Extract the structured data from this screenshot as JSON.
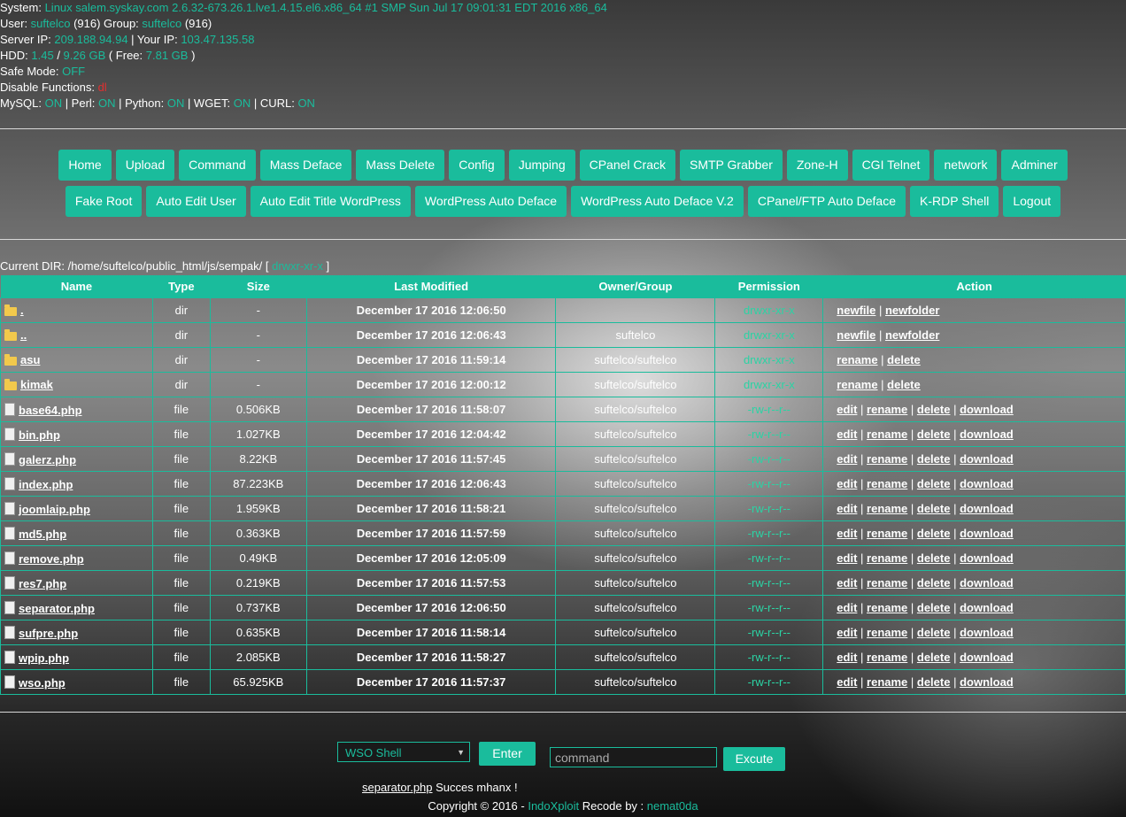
{
  "info": {
    "system_label": "System: ",
    "system_value": "Linux salem.syskay.com 2.6.32-673.26.1.lve1.4.15.el6.x86_64 #1 SMP Sun Jul 17 09:01:31 EDT 2016 x86_64",
    "user_label": "User: ",
    "user_value": "suftelco",
    "user_id": " (916) Group: ",
    "group_value": "suftelco",
    "group_id": " (916)",
    "server_ip_label": "Server IP: ",
    "server_ip": "209.188.94.94",
    "your_ip_label": " | Your IP: ",
    "your_ip": "103.47.135.58",
    "hdd_label": "HDD: ",
    "hdd_used": "1.45",
    "hdd_sep": " / ",
    "hdd_total": "9.26 GB",
    "free_label": " ( Free: ",
    "free_value": "7.81 GB",
    "free_close": " )",
    "safe_mode_label": "Safe Mode: ",
    "safe_mode_value": "OFF",
    "disable_label": "Disable Functions: ",
    "disable_value": "dl",
    "mysql_label": "MySQL: ",
    "mysql_value": "ON",
    "perl_label": " | Perl: ",
    "perl_value": "ON",
    "python_label": " | Python: ",
    "python_value": "ON",
    "wget_label": " | WGET: ",
    "wget_value": "ON",
    "curl_label": " | CURL: ",
    "curl_value": "ON"
  },
  "nav": {
    "row1": [
      "Home",
      "Upload",
      "Command",
      "Mass Deface",
      "Mass Delete",
      "Config",
      "Jumping",
      "CPanel Crack",
      "SMTP Grabber",
      "Zone-H",
      "CGI Telnet",
      "network",
      "Adminer"
    ],
    "row2": [
      "Fake Root",
      "Auto Edit User",
      "Auto Edit Title WordPress",
      "WordPress Auto Deface",
      "WordPress Auto Deface V.2",
      "CPanel/FTP Auto Deface",
      "K-RDP Shell",
      "Logout"
    ]
  },
  "current_dir": {
    "label": "Current DIR: ",
    "path": "/home/suftelco/public_html/js/sempak/",
    "perm_open": "[ ",
    "perm": "drwxr-xr-x",
    "perm_close": " ]"
  },
  "table": {
    "headers": [
      "Name",
      "Type",
      "Size",
      "Last Modified",
      "Owner/Group",
      "Permission",
      "Action"
    ],
    "rows": [
      {
        "icon": "folder-icon",
        "name": ".",
        "type": "dir",
        "size": "-",
        "modified": "December 17 2016 12:06:50",
        "owner": "",
        "perm": "drwxr-xr-x",
        "actions": [
          "newfile",
          "newfolder"
        ]
      },
      {
        "icon": "folder-icon",
        "name": "..",
        "type": "dir",
        "size": "-",
        "modified": "December 17 2016 12:06:43",
        "owner": "suftelco",
        "perm": "drwxr-xr-x",
        "actions": [
          "newfile",
          "newfolder"
        ]
      },
      {
        "icon": "folder-icon",
        "name": "asu",
        "type": "dir",
        "size": "-",
        "modified": "December 17 2016 11:59:14",
        "owner": "suftelco/suftelco",
        "perm": "drwxr-xr-x",
        "actions": [
          "rename",
          "delete"
        ]
      },
      {
        "icon": "folder-icon",
        "name": "kimak",
        "type": "dir",
        "size": "-",
        "modified": "December 17 2016 12:00:12",
        "owner": "suftelco/suftelco",
        "perm": "drwxr-xr-x",
        "actions": [
          "rename",
          "delete"
        ]
      },
      {
        "icon": "file-icon",
        "name": "base64.php",
        "type": "file",
        "size": "0.506KB",
        "modified": "December 17 2016 11:58:07",
        "owner": "suftelco/suftelco",
        "perm": "-rw-r--r--",
        "actions": [
          "edit",
          "rename",
          "delete",
          "download"
        ]
      },
      {
        "icon": "file-icon",
        "name": "bin.php",
        "type": "file",
        "size": "1.027KB",
        "modified": "December 17 2016 12:04:42",
        "owner": "suftelco/suftelco",
        "perm": "-rw-r--r--",
        "actions": [
          "edit",
          "rename",
          "delete",
          "download"
        ]
      },
      {
        "icon": "file-icon",
        "name": "galerz.php",
        "type": "file",
        "size": "8.22KB",
        "modified": "December 17 2016 11:57:45",
        "owner": "suftelco/suftelco",
        "perm": "-rw-r--r--",
        "actions": [
          "edit",
          "rename",
          "delete",
          "download"
        ]
      },
      {
        "icon": "file-icon",
        "name": "index.php",
        "type": "file",
        "size": "87.223KB",
        "modified": "December 17 2016 12:06:43",
        "owner": "suftelco/suftelco",
        "perm": "-rw-r--r--",
        "actions": [
          "edit",
          "rename",
          "delete",
          "download"
        ]
      },
      {
        "icon": "file-icon",
        "name": "joomlaip.php",
        "type": "file",
        "size": "1.959KB",
        "modified": "December 17 2016 11:58:21",
        "owner": "suftelco/suftelco",
        "perm": "-rw-r--r--",
        "actions": [
          "edit",
          "rename",
          "delete",
          "download"
        ]
      },
      {
        "icon": "file-icon",
        "name": "md5.php",
        "type": "file",
        "size": "0.363KB",
        "modified": "December 17 2016 11:57:59",
        "owner": "suftelco/suftelco",
        "perm": "-rw-r--r--",
        "actions": [
          "edit",
          "rename",
          "delete",
          "download"
        ]
      },
      {
        "icon": "file-icon",
        "name": "remove.php",
        "type": "file",
        "size": "0.49KB",
        "modified": "December 17 2016 12:05:09",
        "owner": "suftelco/suftelco",
        "perm": "-rw-r--r--",
        "actions": [
          "edit",
          "rename",
          "delete",
          "download"
        ]
      },
      {
        "icon": "file-icon",
        "name": "res7.php",
        "type": "file",
        "size": "0.219KB",
        "modified": "December 17 2016 11:57:53",
        "owner": "suftelco/suftelco",
        "perm": "-rw-r--r--",
        "actions": [
          "edit",
          "rename",
          "delete",
          "download"
        ]
      },
      {
        "icon": "file-icon",
        "name": "separator.php",
        "type": "file",
        "size": "0.737KB",
        "modified": "December 17 2016 12:06:50",
        "owner": "suftelco/suftelco",
        "perm": "-rw-r--r--",
        "actions": [
          "edit",
          "rename",
          "delete",
          "download"
        ]
      },
      {
        "icon": "file-icon",
        "name": "sufpre.php",
        "type": "file",
        "size": "0.635KB",
        "modified": "December 17 2016 11:58:14",
        "owner": "suftelco/suftelco",
        "perm": "-rw-r--r--",
        "actions": [
          "edit",
          "rename",
          "delete",
          "download"
        ]
      },
      {
        "icon": "file-icon",
        "name": "wpip.php",
        "type": "file",
        "size": "2.085KB",
        "modified": "December 17 2016 11:58:27",
        "owner": "suftelco/suftelco",
        "perm": "-rw-r--r--",
        "actions": [
          "edit",
          "rename",
          "delete",
          "download"
        ]
      },
      {
        "icon": "file-icon",
        "name": "wso.php",
        "type": "file",
        "size": "65.925KB",
        "modified": "December 17 2016 11:57:37",
        "owner": "suftelco/suftelco",
        "perm": "-rw-r--r--",
        "actions": [
          "edit",
          "rename",
          "delete",
          "download"
        ]
      }
    ]
  },
  "bottom": {
    "select_value": "WSO Shell",
    "enter_label": "Enter",
    "command_placeholder": "command",
    "excute_label": "Excute",
    "msg_file": "separator.php",
    "msg_text": " Succes mhanx !",
    "copyright": "Copyright © 2016 - ",
    "brand": "IndoXploit",
    "recode": " Recode by : ",
    "author": "nemat0da"
  },
  "colors": {
    "accent": "#1abc9c",
    "danger": "#e23030"
  }
}
